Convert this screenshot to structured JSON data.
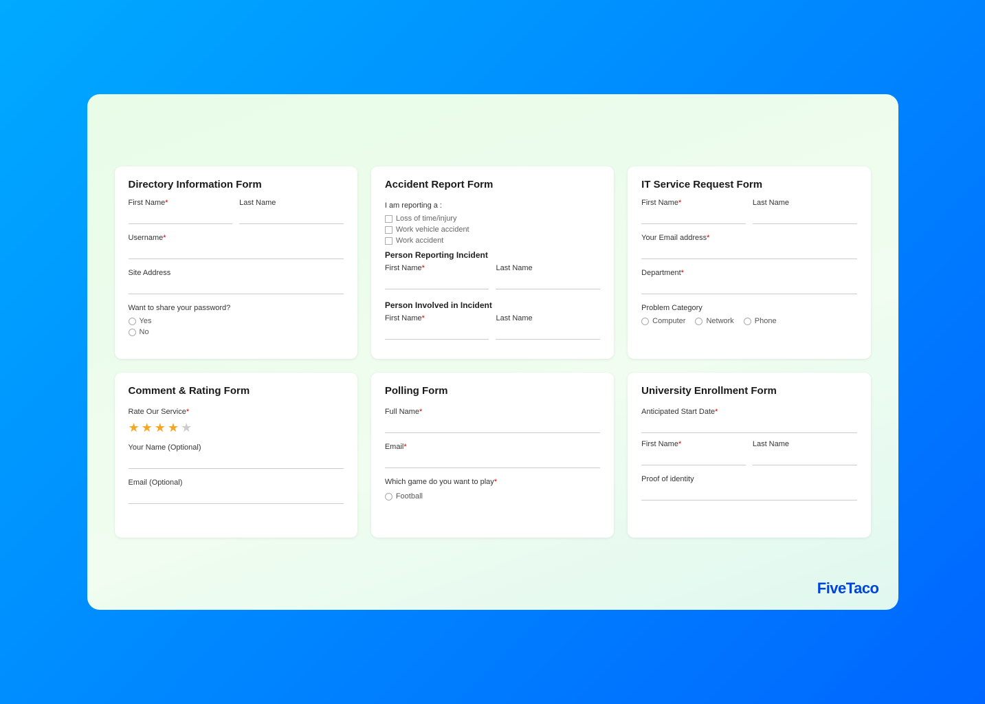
{
  "brand": "FiveTaco",
  "forms": {
    "directory": {
      "title": "Directory Information Form",
      "fields": [
        {
          "label": "First Name",
          "required": true
        },
        {
          "label": "Last Name",
          "required": false
        }
      ],
      "username_label": "Username",
      "username_required": true,
      "site_address_label": "Site Address",
      "password_label": "Want to share your password?",
      "radio_options": [
        "Yes",
        "No"
      ]
    },
    "accident": {
      "title": "Accident Report Form",
      "reporting_label": "I am reporting a :",
      "checkboxes": [
        "Loss of time/injury",
        "Work vehicle accident",
        "Work accident"
      ],
      "person_reporting_label": "Person Reporting Incident",
      "person_involved_label": "Person Involved in Incident",
      "name_fields": [
        {
          "label": "First Name",
          "required": true
        },
        {
          "label": "Last Name",
          "required": false
        }
      ]
    },
    "it_service": {
      "title": "IT Service Request Form",
      "fields": [
        {
          "label": "First Name",
          "required": true
        },
        {
          "label": "Last Name",
          "required": false
        }
      ],
      "email_label": "Your Email address",
      "email_required": true,
      "department_label": "Department",
      "department_required": true,
      "problem_label": "Problem Category",
      "problem_options": [
        "Computer",
        "Network",
        "Phone"
      ]
    },
    "comment_rating": {
      "title": "Comment & Rating Form",
      "rate_label": "Rate Our Service",
      "rate_required": true,
      "stars_filled": 4,
      "stars_total": 5,
      "name_label": "Your Name (Optional)",
      "email_label": "Email (Optional)"
    },
    "polling": {
      "title": "Polling Form",
      "fullname_label": "Full Name",
      "fullname_required": true,
      "email_label": "Email",
      "email_required": true,
      "game_label": "Which game do you want to play",
      "game_required": true,
      "game_options": [
        "Football"
      ]
    },
    "university": {
      "title": "University Enrollment Form",
      "start_date_label": "Anticipated Start Date",
      "start_date_required": true,
      "first_name_label": "First Name",
      "first_name_required": true,
      "last_name_label": "Last Name",
      "identity_label": "Proof of identity"
    }
  }
}
